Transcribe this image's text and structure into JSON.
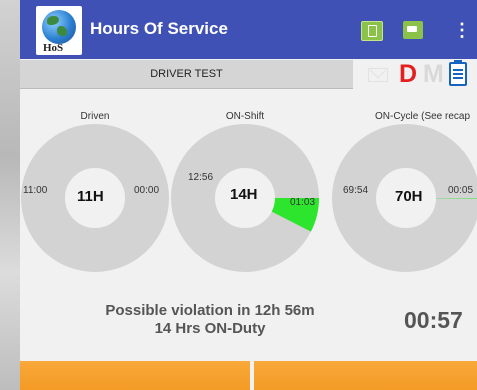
{
  "appbar": {
    "title": "Hours Of Service",
    "logo_text": "HoS",
    "icons": [
      "phone-icon",
      "truck-icon",
      "overflow-menu-icon"
    ]
  },
  "status": {
    "driver_name": "DRIVER TEST",
    "mail_icon": "mail-icon",
    "letter_d": "D",
    "letter_m": "M",
    "clipboard_icon": "clipboard-icon",
    "colors": {
      "d": "#e51f1f",
      "m": "#d9d9d9",
      "accent": "#3f51b5"
    }
  },
  "gauges": [
    {
      "title": "Driven",
      "center": "11H",
      "left": "11:00",
      "right": "00:00",
      "used_fraction": 0.0
    },
    {
      "title": "ON-Shift",
      "center": "14H",
      "left": "12:56",
      "right": "01:03",
      "used_fraction": 0.075
    },
    {
      "title": "ON-Cycle (See recap",
      "center": "70H",
      "left": "69:54",
      "right": "00:05",
      "used_fraction": 0.001
    }
  ],
  "footer": {
    "violation_line1": "Possible violation in 12h 56m",
    "violation_line2": "14 Hrs ON-Duty",
    "timer": "00:57"
  }
}
